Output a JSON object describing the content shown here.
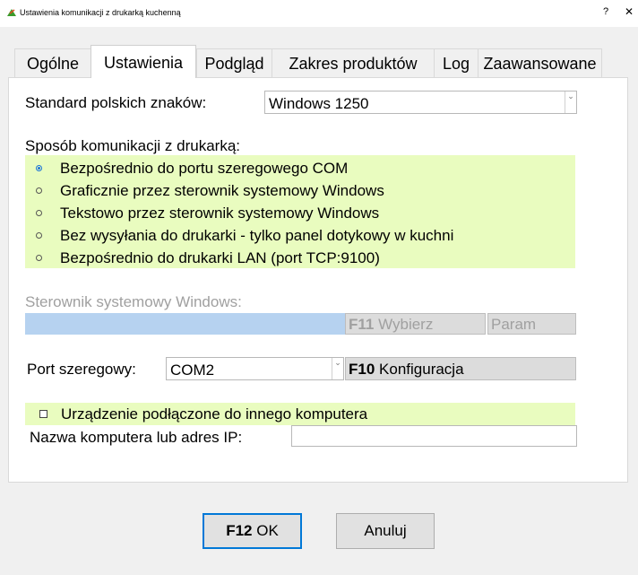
{
  "window": {
    "title": "Ustawienia komunikacji z drukarką kuchenną",
    "help": "?",
    "close": "✕"
  },
  "tabs": [
    {
      "label": "Ogólne"
    },
    {
      "label": "Ustawienia"
    },
    {
      "label": "Podgląd"
    },
    {
      "label": "Zakres produktów"
    },
    {
      "label": "Log"
    },
    {
      "label": "Zaawansowane"
    }
  ],
  "charset": {
    "label": "Standard polskich znaków:",
    "value": "Windows 1250"
  },
  "communication": {
    "label": "Sposób komunikacji z drukarką:",
    "options": [
      {
        "label": "Bezpośrednio do portu szeregowego COM",
        "selected": true
      },
      {
        "label": "Graficznie przez sterownik systemowy Windows",
        "selected": false
      },
      {
        "label": "Tekstowo przez sterownik systemowy Windows",
        "selected": false
      },
      {
        "label": "Bez wysyłania do drukarki - tylko panel dotykowy w kuchni",
        "selected": false
      },
      {
        "label": "Bezpośrednio do drukarki LAN (port TCP:9100)",
        "selected": false
      }
    ]
  },
  "driver": {
    "label": "Sterownik systemowy Windows:",
    "value": "",
    "select_key": "F11",
    "select_label": "Wybierz",
    "param_label": "Param"
  },
  "serial": {
    "label": "Port szeregowy:",
    "value": "COM2",
    "config_key": "F10",
    "config_label": "Konfiguracja"
  },
  "remote": {
    "checkbox_label": "Urządzenie podłączone do innego komputera",
    "checked": false,
    "ip_label": "Nazwa komputera lub adres IP:",
    "ip_value": ""
  },
  "buttons": {
    "ok_key": "F12",
    "ok_label": "OK",
    "cancel_label": "Anuluj"
  },
  "colors": {
    "highlight": "#e9fcbf",
    "driver_field": "#b6d2f0",
    "accent": "#0078d7"
  }
}
